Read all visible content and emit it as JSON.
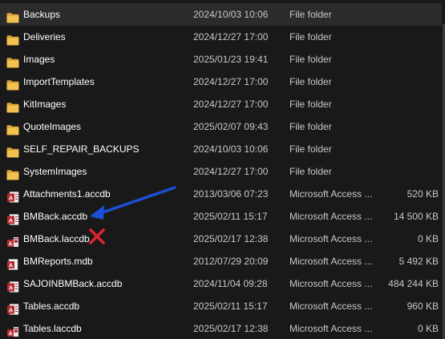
{
  "files": [
    {
      "name": "Backups",
      "date": "2024/10/03 10:06",
      "type": "File folder",
      "size": "",
      "icon": "folder-icon",
      "selected": true
    },
    {
      "name": "Deliveries",
      "date": "2024/12/27 17:00",
      "type": "File folder",
      "size": "",
      "icon": "folder-icon"
    },
    {
      "name": "Images",
      "date": "2025/01/23 19:41",
      "type": "File folder",
      "size": "",
      "icon": "folder-icon"
    },
    {
      "name": "ImportTemplates",
      "date": "2024/12/27 17:00",
      "type": "File folder",
      "size": "",
      "icon": "folder-icon"
    },
    {
      "name": "KitImages",
      "date": "2024/12/27 17:00",
      "type": "File folder",
      "size": "",
      "icon": "folder-icon"
    },
    {
      "name": "QuoteImages",
      "date": "2025/02/07 09:43",
      "type": "File folder",
      "size": "",
      "icon": "folder-icon"
    },
    {
      "name": "SELF_REPAIR_BACKUPS",
      "date": "2024/10/03 10:06",
      "type": "File folder",
      "size": "",
      "icon": "folder-icon"
    },
    {
      "name": "SystemImages",
      "date": "2024/12/27 17:00",
      "type": "File folder",
      "size": "",
      "icon": "folder-icon"
    },
    {
      "name": "Attachments1.accdb",
      "date": "2013/03/06 07:23",
      "type": "Microsoft Access ...",
      "size": "520 KB",
      "icon": "access-database-icon"
    },
    {
      "name": "BMBack.accdb",
      "date": "2025/02/11 15:17",
      "type": "Microsoft Access ...",
      "size": "14 500 KB",
      "icon": "access-database-icon"
    },
    {
      "name": "BMBack.laccdb",
      "date": "2025/02/17 12:38",
      "type": "Microsoft Access ...",
      "size": "0 KB",
      "icon": "access-lock-file-icon"
    },
    {
      "name": "BMReports.mdb",
      "date": "2012/07/29 20:09",
      "type": "Microsoft Access ...",
      "size": "5 492 KB",
      "icon": "access-mdb-icon"
    },
    {
      "name": "SAJOINBMBack.accdb",
      "date": "2024/11/04 09:28",
      "type": "Microsoft Access ...",
      "size": "484 244 KB",
      "icon": "access-database-icon"
    },
    {
      "name": "Tables.accdb",
      "date": "2025/02/11 15:17",
      "type": "Microsoft Access ...",
      "size": "960 KB",
      "icon": "access-database-icon"
    },
    {
      "name": "Tables.laccdb",
      "date": "2025/02/17 12:38",
      "type": "Microsoft Access ...",
      "size": "0 KB",
      "icon": "access-lock-file-icon"
    }
  ],
  "annotations": {
    "arrow_color": "#1a4fd6",
    "cross_color": "#e0252b"
  },
  "colors": {
    "background": "#191919",
    "selected_row": "#2b2b2b",
    "folder": "#f2c14e",
    "access_red": "#b42a2f"
  }
}
